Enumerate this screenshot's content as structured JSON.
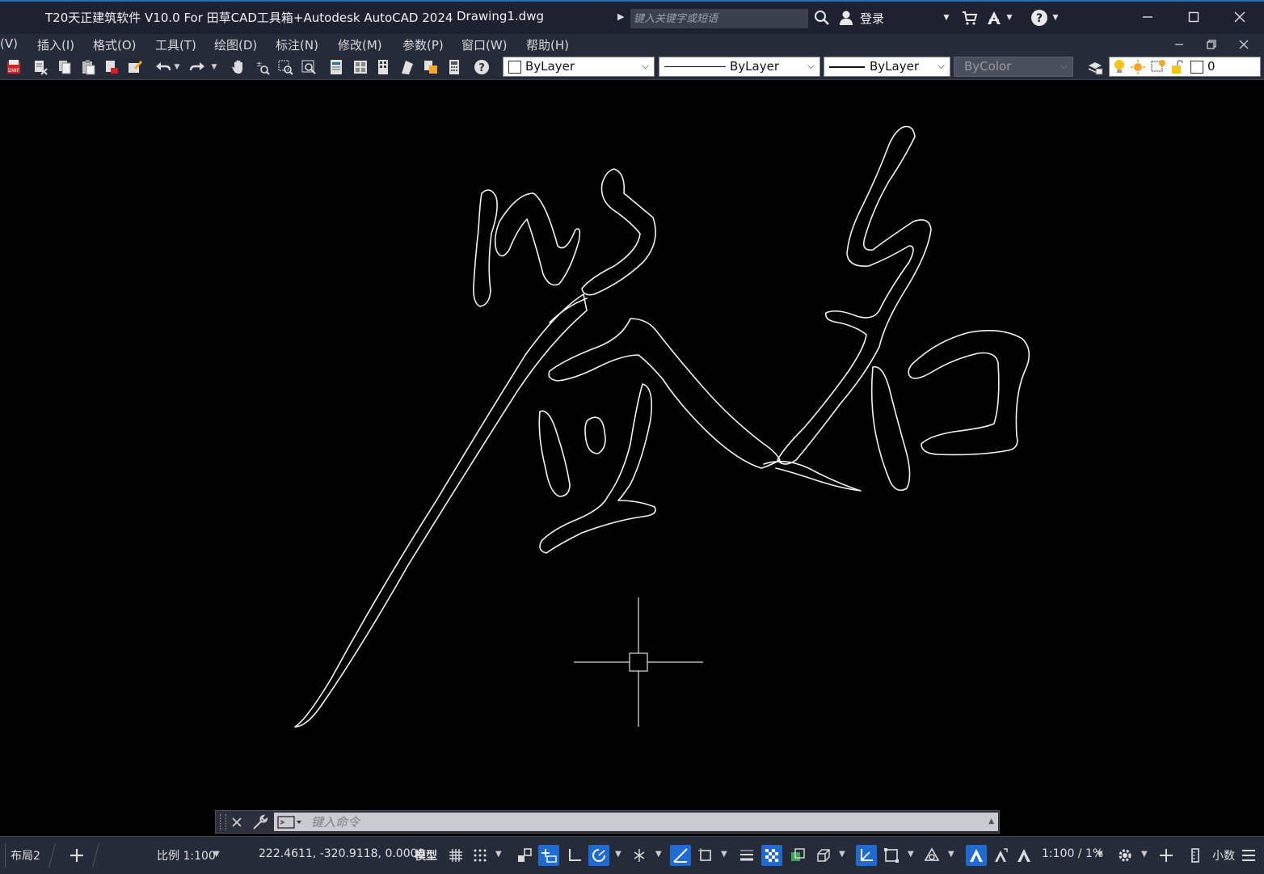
{
  "window": {
    "app_title": "T20天正建筑软件 V10.0 For 田草CAD工具箱+Autodesk AutoCAD 2024",
    "document": "Drawing1.dwg",
    "search_placeholder": "键入关键字或短语",
    "login": "登录"
  },
  "menu": {
    "items": [
      "(V)",
      "插入(I)",
      "格式(O)",
      "工具(T)",
      "绘图(D)",
      "标注(N)",
      "修改(M)",
      "参数(P)",
      "窗口(W)",
      "帮助(H)"
    ]
  },
  "properties": {
    "color": "ByLayer",
    "linetype": "ByLayer",
    "lineweight": "ByLayer",
    "plotstyle": "ByColor",
    "layer": "0"
  },
  "command": {
    "placeholder": "键入命令"
  },
  "status": {
    "layout_tab": "布局2",
    "scale": "比例 1:100",
    "coordinates": "222.4611, -320.9118, 0.0000",
    "space": "模型",
    "annotation_scale": "1:100 / 1%",
    "units_label": "小数"
  },
  "colors": {
    "title_bg": "#1e2230",
    "bar_bg": "#262b3a",
    "canvas_bg": "#000000",
    "accent_blue": "#1f6bd1"
  }
}
